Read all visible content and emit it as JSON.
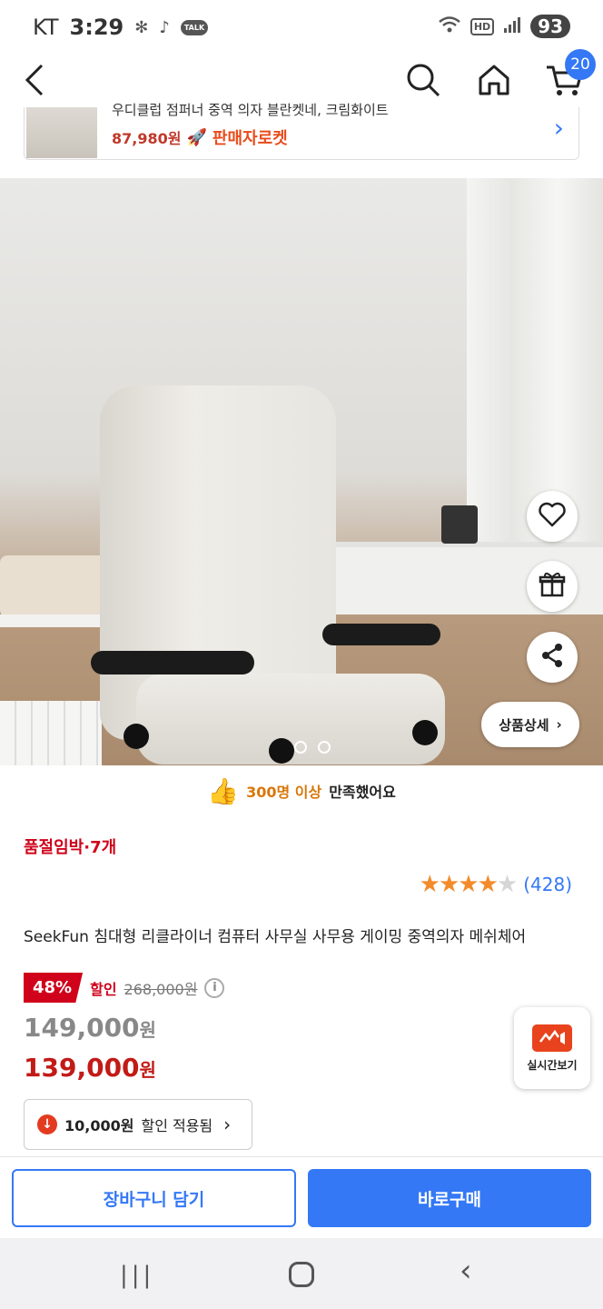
{
  "status_bar": {
    "carrier": "KT",
    "time": "3:29",
    "talk_badge": "TALK",
    "hd": "HD",
    "battery": "93"
  },
  "nav": {
    "cart_count": "20"
  },
  "promo_banner": {
    "title": "우디클럽 점퍼너 중역 의자 블란켓네, 크림화이트",
    "price": "87,980원",
    "badge": "판매자로켓"
  },
  "hero": {
    "detail_button": "상품상세"
  },
  "satisfaction": {
    "highlight": "300명 이상",
    "rest": "만족했어요"
  },
  "stock_notice": "품절임박·7개",
  "rating": {
    "stars": 4.5,
    "count": "(428)"
  },
  "product_title": "SeekFun 침대형 리클라이너 컴퓨터 사무실 사무용 게이밍 중역의자 메쉬체어",
  "pricing": {
    "discount_rate": "48%",
    "discount_label": "할인",
    "original_price": "268,000원",
    "price_before_coupon": "149,000",
    "final_price": "139,000",
    "currency": "원"
  },
  "coupon": {
    "amount": "10,000원",
    "text": "할인 적용됨"
  },
  "live_button": {
    "label": "실시간보기"
  },
  "actions": {
    "add_to_cart": "장바구니 담기",
    "buy_now": "바로구매"
  },
  "colors": {
    "accent": "#3478f6",
    "sale": "#d0021b",
    "star": "#f38b2b"
  }
}
